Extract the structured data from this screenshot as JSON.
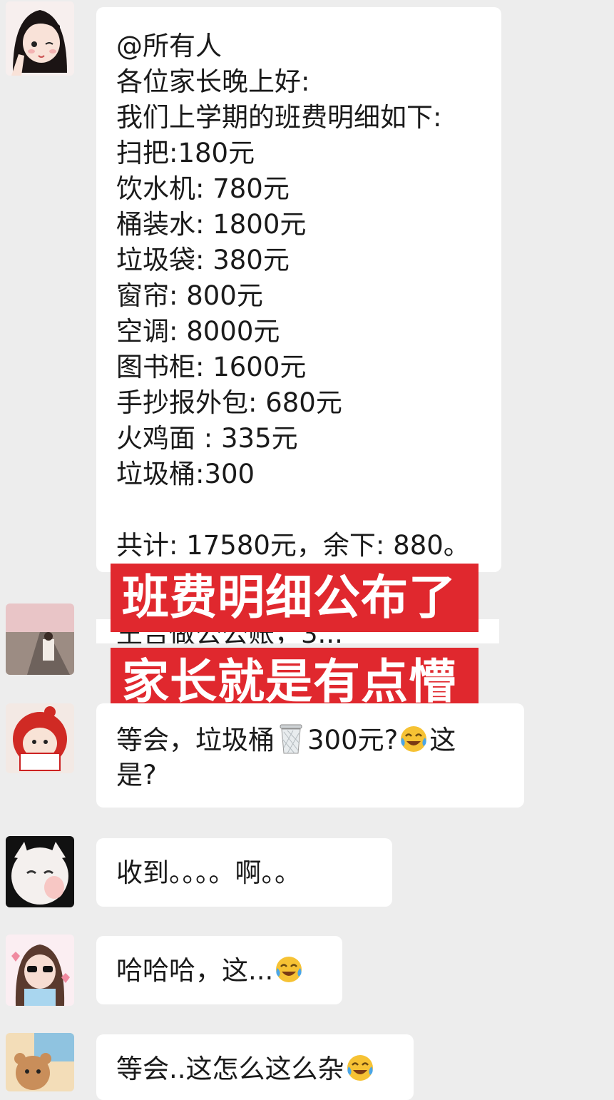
{
  "messages": [
    {
      "lines": [
        "@所有人",
        "各位家长晚上好:",
        "我们上学期的班费明细如下:",
        "扫把:180元",
        "饮水机: 780元",
        "桶装水: 1800元",
        "垃圾袋: 380元",
        "窗帘: 800元",
        "空调: 8000元",
        "图书柜: 1600元",
        "手抄报外包: 680元",
        "火鸡面 : 335元",
        "垃圾桶:300",
        "",
        "共计: 17580元，余下: 880。"
      ]
    },
    {
      "covered_text": "王吉做公公账，3..."
    },
    {
      "part1": "等会，垃圾桶",
      "part2": "300元?",
      "part3": "这",
      "line2": "是?"
    },
    {
      "text": "收到。。。。啊。。"
    },
    {
      "text": "哈哈哈，这..."
    },
    {
      "text": "等会..这怎么这么杂"
    }
  ],
  "banners": {
    "line1": "班费明细公布了",
    "line2": "家长就是有点懵"
  },
  "colors": {
    "banner_red": "#e0282e",
    "chat_bg": "#ededed",
    "bubble_bg": "#ffffff"
  },
  "icons": [
    "cry-laugh-emoji",
    "trash-bin-emoji"
  ]
}
